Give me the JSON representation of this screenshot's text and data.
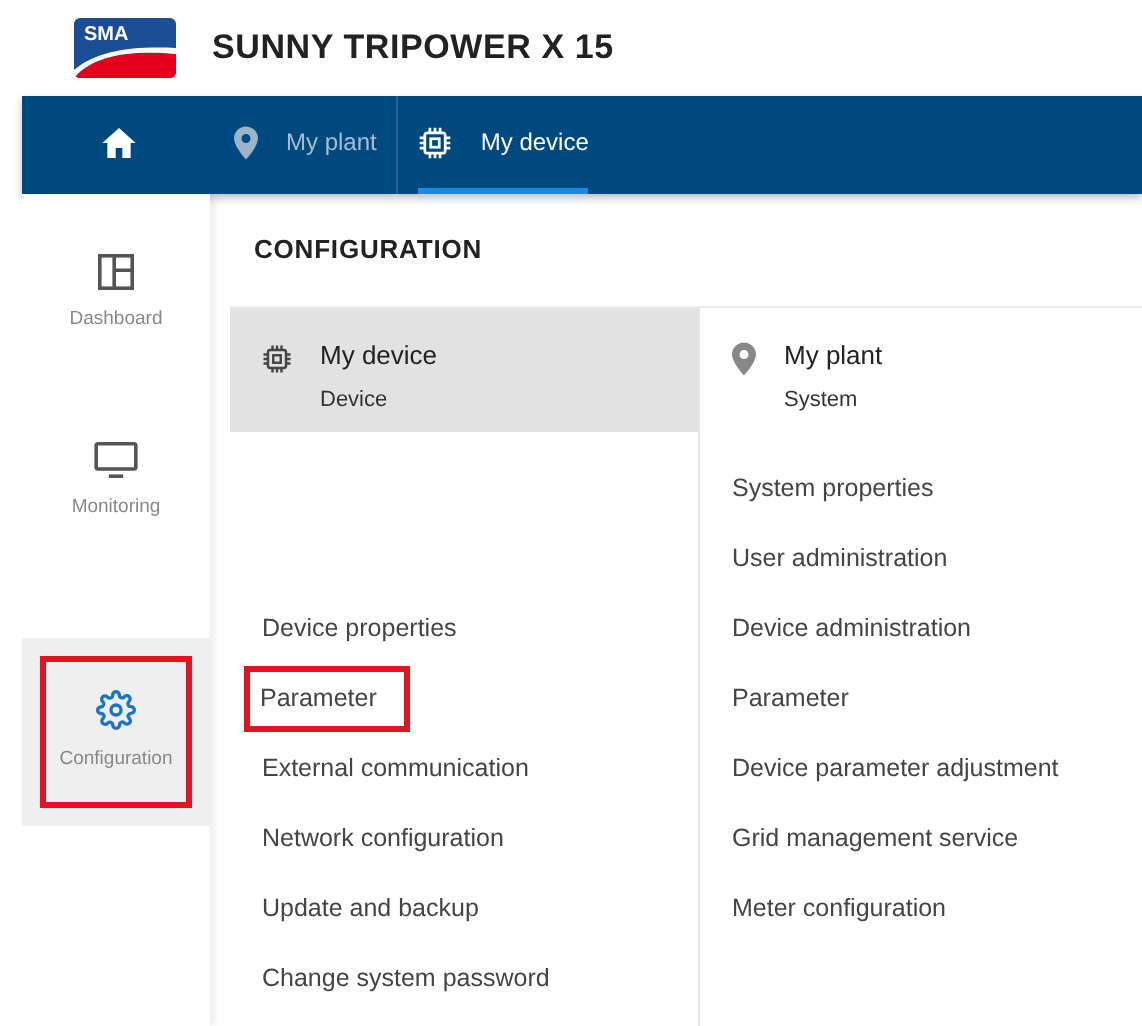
{
  "header": {
    "logo": "SMA",
    "title": "SUNNY TRIPOWER X 15"
  },
  "breadcrumb": [
    {
      "kind": "home",
      "selected": false
    },
    {
      "kind": "plant",
      "label": "My plant",
      "selected": false
    },
    {
      "kind": "device",
      "label": "My device",
      "selected": true
    }
  ],
  "sidebar": {
    "items": [
      {
        "kind": "dashboard",
        "label": "Dashboard",
        "selected": false,
        "highlighted": false
      },
      {
        "kind": "monitoring",
        "label": "Monitoring",
        "selected": false,
        "highlighted": false
      },
      {
        "kind": "configuration",
        "label": "Configuration",
        "selected": true,
        "highlighted": true
      }
    ]
  },
  "configuration": {
    "title": "CONFIGURATION",
    "columns": [
      {
        "kind": "device",
        "title": "My device",
        "subtitle": "Device",
        "selected": true,
        "items": [
          {
            "label": "Device properties",
            "highlighted": false
          },
          {
            "label": "Parameter",
            "highlighted": true
          },
          {
            "label": "External communication",
            "highlighted": false
          },
          {
            "label": "Network configuration",
            "highlighted": false
          },
          {
            "label": "Update and backup",
            "highlighted": false
          },
          {
            "label": "Change system password",
            "highlighted": false
          }
        ]
      },
      {
        "kind": "plant",
        "title": "My plant",
        "subtitle": "System",
        "selected": false,
        "items": [
          {
            "label": "System properties",
            "highlighted": false
          },
          {
            "label": "User administration",
            "highlighted": false
          },
          {
            "label": "Device administration",
            "highlighted": false
          },
          {
            "label": "Parameter",
            "highlighted": false
          },
          {
            "label": "Device parameter adjustment",
            "highlighted": false
          },
          {
            "label": "Grid management service",
            "highlighted": false
          },
          {
            "label": "Meter configuration",
            "highlighted": false
          }
        ]
      }
    ]
  }
}
